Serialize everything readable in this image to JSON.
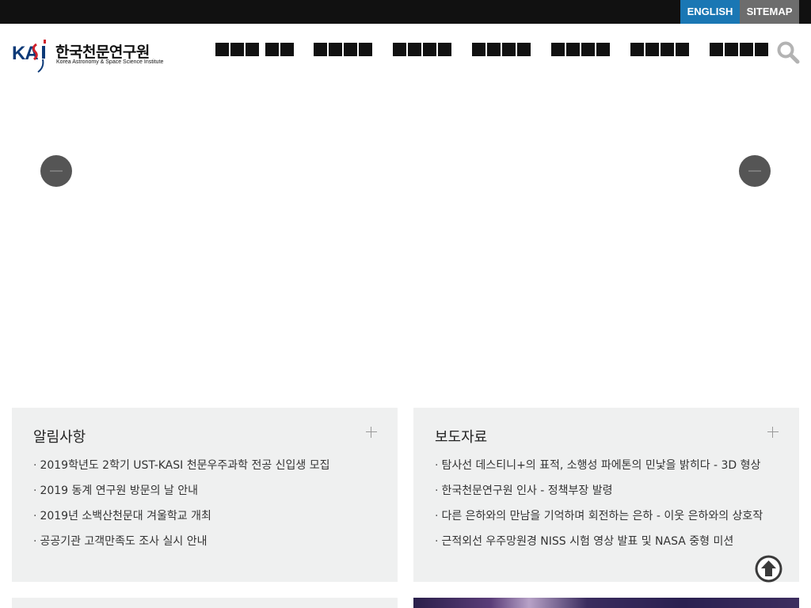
{
  "topbar": {
    "english_label": "ENGLISH",
    "sitemap_label": "SITEMAP",
    "english_color": "#1a77b4",
    "sitemap_color": "#6d6d6d"
  },
  "logo": {
    "mark_text": "KASI",
    "name_ko": "한국천문연구원",
    "name_en": "Korea Astronomy & Space Science Institute"
  },
  "gnb": {
    "note": "",
    "items": [
      {
        "glyphs": [
          3,
          2
        ]
      },
      {
        "glyphs": [
          4
        ]
      },
      {
        "glyphs": [
          4
        ]
      },
      {
        "glyphs": [
          4
        ]
      },
      {
        "glyphs": [
          4
        ]
      },
      {
        "glyphs": [
          4
        ]
      },
      {
        "glyphs": [
          4
        ]
      }
    ]
  },
  "icons": {
    "search": "search-icon",
    "prev": "arrow-left-icon",
    "next": "arrow-right-icon",
    "more": "plus-icon",
    "top": "arrow-up-circle-icon"
  },
  "notice": {
    "title": "알림사항",
    "items": [
      "2019학년도 2학기 UST-KASI 천문우주과학 전공 신입생 모집",
      "2019 동계 연구원 방문의 날 안내",
      "2019년 소백산천문대 겨울학교 개최",
      "공공기관 고객만족도 조사 실시 안내"
    ]
  },
  "press": {
    "title": "보도자료",
    "items": [
      "탐사선 데스티니+의 표적, 소행성 파에톤의 민낯을 밝히다 - 3D 형상",
      "한국천문연구원 인사 - 정책부장 발령",
      "다른 은하와의 만남을 기억하며 회전하는 은하 - 이웃 은하와의 상호작",
      "근적외선 우주망원경 NISS 시험 영상 발표 및 NASA 중형 미션"
    ]
  }
}
